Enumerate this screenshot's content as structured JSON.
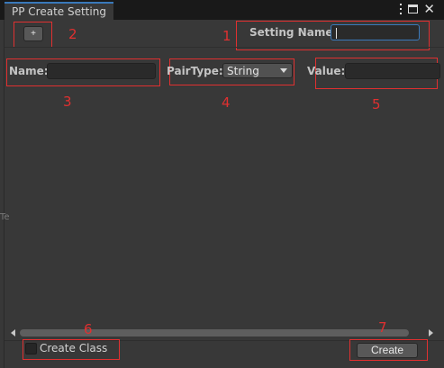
{
  "window": {
    "tab_title": "PP Create Setting",
    "icons": [
      "kebab-menu-icon",
      "maximize-icon",
      "close-icon"
    ]
  },
  "header": {
    "add_button_label": "+",
    "setting_name_label": "Setting Name:",
    "setting_name_value": ""
  },
  "row": {
    "name_label": "Name:",
    "name_value": "",
    "pair_type_label": "PairType:",
    "pair_type_selected": "String",
    "value_label": "Value:",
    "value_value": ""
  },
  "footer": {
    "create_class_label": "Create Class",
    "create_class_checked": false,
    "create_button_label": "Create"
  },
  "annotations": [
    "1",
    "2",
    "3",
    "4",
    "5",
    "6",
    "7"
  ],
  "edge_glyph": "Te",
  "colors": {
    "background": "#383838",
    "titlebar": "#191919",
    "accent": "#3a79bb",
    "annotation_red": "#e03030"
  }
}
